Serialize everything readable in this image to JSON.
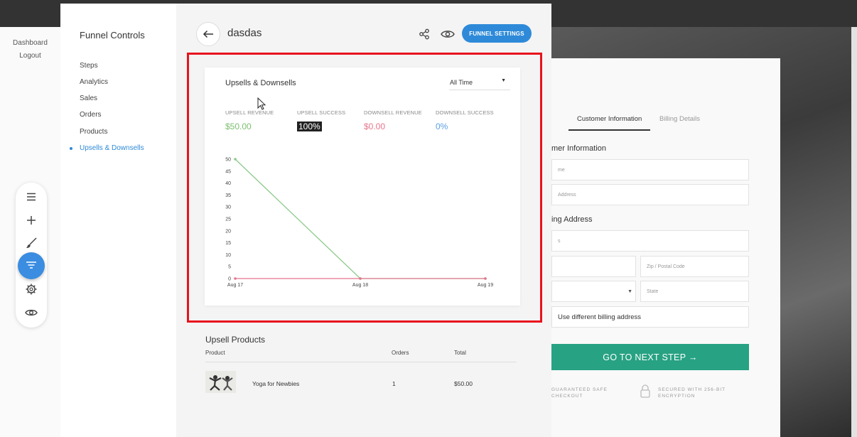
{
  "left_links": {
    "dashboard": "Dashboard",
    "logout": "Logout"
  },
  "toolbar": {
    "icons": [
      "menu-icon",
      "plus-icon",
      "brush-icon",
      "funnel-filter-icon",
      "gear-icon",
      "eye-icon"
    ],
    "active": "funnel-filter-icon",
    "accent": "#3a8de0"
  },
  "funnel_panel": {
    "title": "Funnel Controls",
    "items": [
      {
        "label": "Steps"
      },
      {
        "label": "Analytics"
      },
      {
        "label": "Sales"
      },
      {
        "label": "Orders"
      },
      {
        "label": "Products"
      },
      {
        "label": "Upsells & Downsells",
        "active": true
      }
    ]
  },
  "header": {
    "title": "dasdas",
    "settings_label": "FUNNEL SETTINGS",
    "accent": "#2e8ad8"
  },
  "card": {
    "title": "Upsells & Downsells",
    "range": "All Time",
    "stats": [
      {
        "label": "UPSELL REVENUE",
        "value": "$50.00",
        "color": "#7cc06f"
      },
      {
        "label": "UPSELL SUCCESS",
        "value": "100%",
        "color": "#7cc06f"
      },
      {
        "label": "DOWNSELL REVENUE",
        "value": "$0.00",
        "color": "#e6758e"
      },
      {
        "label": "DOWNSELL SUCCESS",
        "value": "0%",
        "color": "#5a9ee6"
      }
    ]
  },
  "chart_data": {
    "type": "line",
    "x": [
      "Aug 17",
      "Aug 18",
      "Aug 19"
    ],
    "series": [
      {
        "values": [
          50,
          0,
          0
        ],
        "color": "#8cc98a"
      },
      {
        "values": [
          0,
          0,
          0
        ],
        "color": "#e6758e"
      }
    ],
    "yticks": [
      0,
      5,
      10,
      15,
      20,
      25,
      30,
      35,
      40,
      45,
      50
    ],
    "ylim": [
      0,
      50
    ],
    "title": "",
    "xlabel": "",
    "ylabel": "",
    "grid": false
  },
  "upsell_products": {
    "title": "Upsell Products",
    "columns": [
      "Product",
      "Orders",
      "Total"
    ],
    "rows": [
      {
        "product": "Yoga for Newbies",
        "orders": "1",
        "total": "$50.00"
      }
    ]
  },
  "checkout": {
    "tabs": [
      "Customer Information",
      "Billing Details"
    ],
    "customer_heading": "mer Information",
    "customer_fields": [
      "me",
      "Address"
    ],
    "billing_heading": "ing Address",
    "billing_fields": [
      "s",
      "",
      "Zip / Postal Code",
      "",
      "State"
    ],
    "billing_option": "Use different billing address",
    "next_button": "GO TO NEXT STEP →",
    "next_button_color": "#27a283",
    "note_left": "GUARANTEED SAFE\nCHECKOUT",
    "note_right": "SECURED WITH 256-BIT\nENCRYPTION"
  }
}
